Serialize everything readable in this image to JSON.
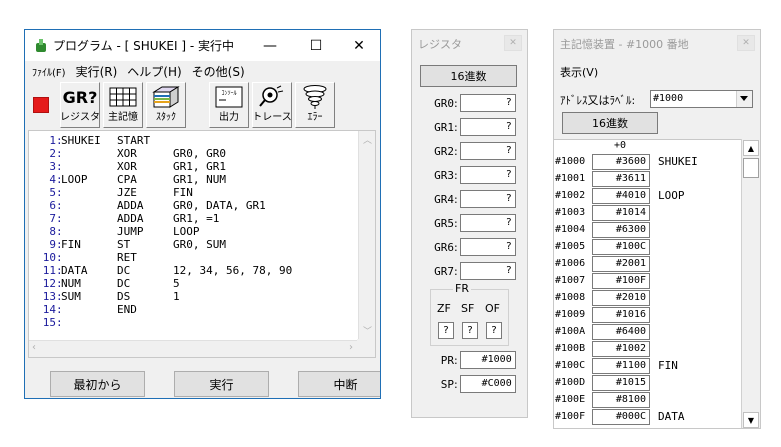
{
  "main_window": {
    "title": "プログラム - [ SHUKEI ] - 実行中",
    "minimize": "—",
    "maximize": "☐",
    "close": "✕",
    "menu": [
      {
        "label": "ﾌｧｲﾙ(F)",
        "small": true
      },
      {
        "label": "実行(R)",
        "small": false
      },
      {
        "label": "ヘルプ(H)",
        "small": false
      },
      {
        "label": "その他(S)",
        "small": false
      }
    ],
    "toolbar": {
      "register": "レジスタ",
      "memory": "主記憶",
      "stack": "ｽﾀｯｸ",
      "output": "出力",
      "trace": "トレース",
      "error": "ｴﾗｰ",
      "gr_icon_text": "GR?",
      "output_icon_text": "ｺﾝｿｰﾙ"
    },
    "code_lines": [
      {
        "n": "1",
        "label": "SHUKEI",
        "op": "START",
        "arg": ""
      },
      {
        "n": "2",
        "label": "",
        "op": "XOR",
        "arg": "GR0, GR0"
      },
      {
        "n": "3",
        "label": "",
        "op": "XOR",
        "arg": "GR1, GR1"
      },
      {
        "n": "4",
        "label": "LOOP",
        "op": "CPA",
        "arg": "GR1, NUM"
      },
      {
        "n": "5",
        "label": "",
        "op": "JZE",
        "arg": "FIN"
      },
      {
        "n": "6",
        "label": "",
        "op": "ADDA",
        "arg": "GR0, DATA, GR1"
      },
      {
        "n": "7",
        "label": "",
        "op": "ADDA",
        "arg": "GR1, =1"
      },
      {
        "n": "8",
        "label": "",
        "op": "JUMP",
        "arg": "LOOP"
      },
      {
        "n": "9",
        "label": "FIN",
        "op": "ST",
        "arg": "GR0, SUM"
      },
      {
        "n": "10",
        "label": "",
        "op": "RET",
        "arg": ""
      },
      {
        "n": "11",
        "label": "DATA",
        "op": "DC",
        "arg": "12, 34, 56, 78, 90"
      },
      {
        "n": "12",
        "label": "NUM",
        "op": "DC",
        "arg": "5"
      },
      {
        "n": "13",
        "label": "SUM",
        "op": "DS",
        "arg": "1"
      },
      {
        "n": "14",
        "label": "",
        "op": "END",
        "arg": ""
      },
      {
        "n": "15",
        "label": "",
        "op": "",
        "arg": ""
      }
    ],
    "current_line": 2,
    "buttons": {
      "first": "最初から",
      "run": "実行",
      "stop": "中断"
    },
    "accent": "#1f6fb5",
    "stop_color": "#e51a1a"
  },
  "register_window": {
    "title": "レジスタ",
    "close": "✕",
    "hex_button": "16進数",
    "registers": [
      {
        "name": "GR0",
        "value": "?"
      },
      {
        "name": "GR1",
        "value": "?"
      },
      {
        "name": "GR2",
        "value": "?"
      },
      {
        "name": "GR3",
        "value": "?"
      },
      {
        "name": "GR4",
        "value": "?"
      },
      {
        "name": "GR5",
        "value": "?"
      },
      {
        "name": "GR6",
        "value": "?"
      },
      {
        "name": "GR7",
        "value": "?"
      }
    ],
    "flags_title": "FR",
    "flags": [
      {
        "name": "ZF",
        "value": "?"
      },
      {
        "name": "SF",
        "value": "?"
      },
      {
        "name": "OF",
        "value": "?"
      }
    ],
    "pr": {
      "name": "PR",
      "value": "#1000"
    },
    "sp": {
      "name": "SP",
      "value": "#C000"
    }
  },
  "memory_window": {
    "title": "主記憶装置 - #1000 番地",
    "close": "✕",
    "menu": "表示(V)",
    "address_label": "ｱﾄﾞﾚｽ又はﾗﾍﾞﾙ:",
    "address_value": "#1000",
    "hex_button": "16進数",
    "offset_header": "+0",
    "rows": [
      {
        "addr": "#1000",
        "value": "#3600",
        "label": "SHUKEI"
      },
      {
        "addr": "#1001",
        "value": "#3611",
        "label": ""
      },
      {
        "addr": "#1002",
        "value": "#4010",
        "label": "LOOP"
      },
      {
        "addr": "#1003",
        "value": "#1014",
        "label": ""
      },
      {
        "addr": "#1004",
        "value": "#6300",
        "label": ""
      },
      {
        "addr": "#1005",
        "value": "#100C",
        "label": ""
      },
      {
        "addr": "#1006",
        "value": "#2001",
        "label": ""
      },
      {
        "addr": "#1007",
        "value": "#100F",
        "label": ""
      },
      {
        "addr": "#1008",
        "value": "#2010",
        "label": ""
      },
      {
        "addr": "#1009",
        "value": "#1016",
        "label": ""
      },
      {
        "addr": "#100A",
        "value": "#6400",
        "label": ""
      },
      {
        "addr": "#100B",
        "value": "#1002",
        "label": ""
      },
      {
        "addr": "#100C",
        "value": "#1100",
        "label": "FIN"
      },
      {
        "addr": "#100D",
        "value": "#1015",
        "label": ""
      },
      {
        "addr": "#100E",
        "value": "#8100",
        "label": ""
      },
      {
        "addr": "#100F",
        "value": "#000C",
        "label": "DATA"
      }
    ]
  }
}
